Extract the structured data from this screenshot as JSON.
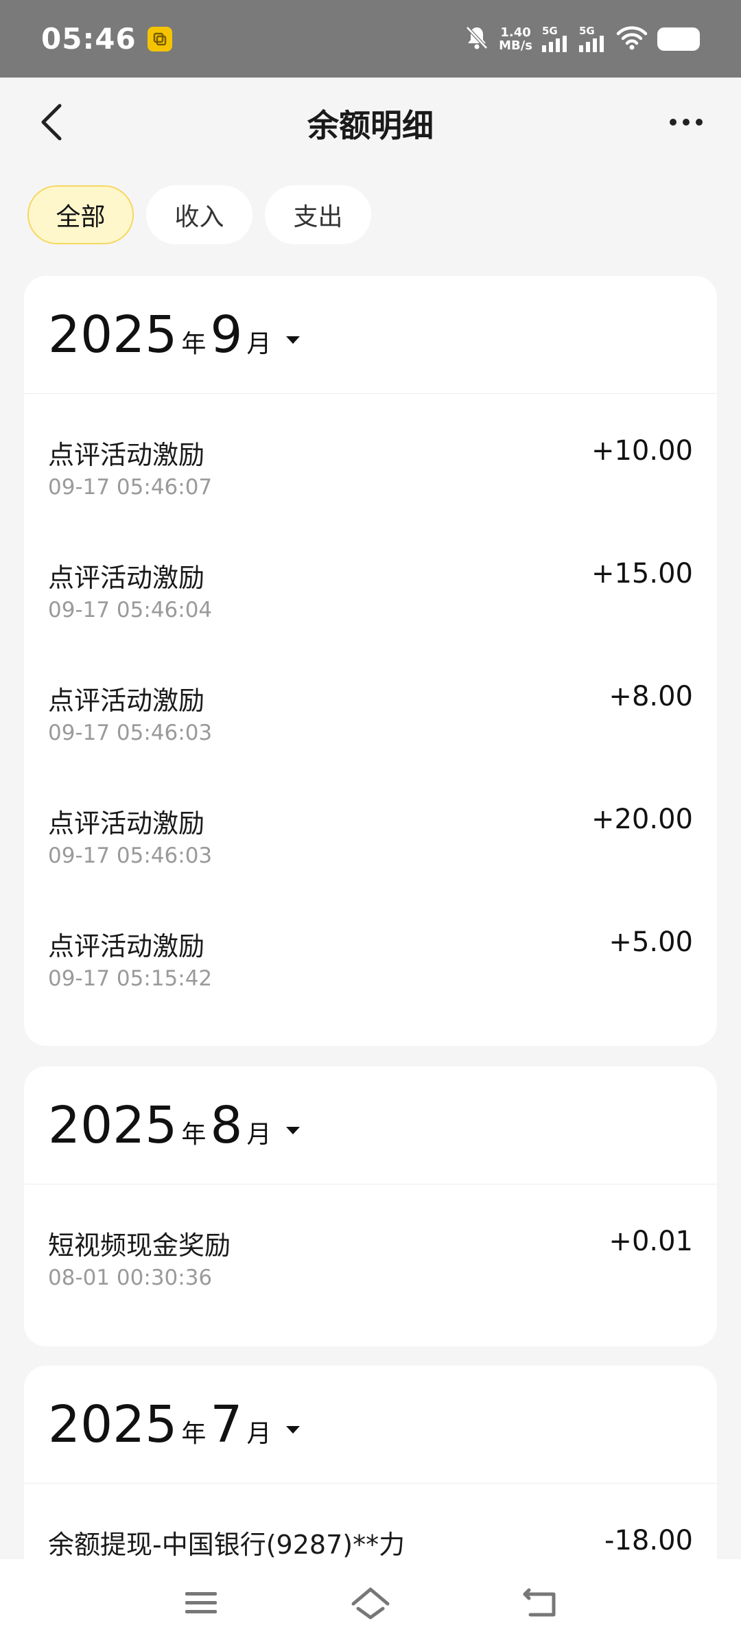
{
  "status_bar": {
    "time": "05:46",
    "speed_value": "1.40",
    "speed_unit": "MB/s",
    "sim1": "5G",
    "sim2": "5G"
  },
  "header": {
    "title": "余额明细"
  },
  "tabs": [
    {
      "label": "全部",
      "active": true
    },
    {
      "label": "收入",
      "active": false
    },
    {
      "label": "支出",
      "active": false
    }
  ],
  "months": [
    {
      "year": "2025",
      "year_suffix": "年",
      "month": "9",
      "month_suffix": "月",
      "items": [
        {
          "name": "点评活动激励",
          "time": "09-17 05:46:07",
          "amount": "+10.00"
        },
        {
          "name": "点评活动激励",
          "time": "09-17 05:46:04",
          "amount": "+15.00"
        },
        {
          "name": "点评活动激励",
          "time": "09-17 05:46:03",
          "amount": "+8.00"
        },
        {
          "name": "点评活动激励",
          "time": "09-17 05:46:03",
          "amount": "+20.00"
        },
        {
          "name": "点评活动激励",
          "time": "09-17 05:15:42",
          "amount": "+5.00"
        }
      ]
    },
    {
      "year": "2025",
      "year_suffix": "年",
      "month": "8",
      "month_suffix": "月",
      "items": [
        {
          "name": "短视频现金奖励",
          "time": "08-01 00:30:36",
          "amount": "+0.01"
        }
      ]
    },
    {
      "year": "2025",
      "year_suffix": "年",
      "month": "7",
      "month_suffix": "月",
      "items": [
        {
          "name": "余额提现-中国银行(9287)**力",
          "time": "",
          "amount": "-18.00"
        }
      ]
    }
  ],
  "colors": {
    "accent_tab_bg": "#fff7cc",
    "accent_tab_border": "#f5d860",
    "status_bar": "#7a7a7a"
  },
  "icons": [
    "back-arrow-icon",
    "more-dots-icon",
    "menu-icon",
    "home-icon",
    "return-icon"
  ]
}
